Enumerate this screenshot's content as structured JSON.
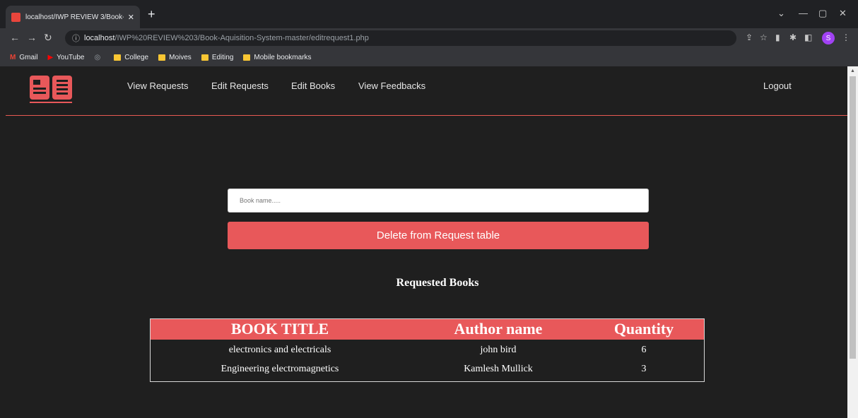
{
  "browser": {
    "tab_title": "localhost/IWP REVIEW 3/Book-A",
    "tab_close": "✕",
    "new_tab": "+",
    "url_host": "localhost",
    "url_path": "/IWP%20REVIEW%203/Book-Aquisition-System-master/editrequest1.php",
    "profile_initial": "S",
    "bookmarks": [
      {
        "label": "Gmail",
        "icon": "gmail-icon"
      },
      {
        "label": "YouTube",
        "icon": "youtube-icon"
      },
      {
        "label": "",
        "icon": "globe-icon"
      },
      {
        "label": "College",
        "icon": "folder-icon"
      },
      {
        "label": "Moives",
        "icon": "folder-icon"
      },
      {
        "label": "Editing",
        "icon": "folder-icon"
      },
      {
        "label": "Mobile bookmarks",
        "icon": "folder-icon"
      }
    ]
  },
  "nav": {
    "links": [
      "View Requests",
      "Edit Requests",
      "Edit Books",
      "View Feedbacks"
    ],
    "logout": "Logout"
  },
  "form": {
    "placeholder": "Book name.....",
    "delete_label": "Delete from Request table"
  },
  "section_title": "Requested Books",
  "table": {
    "headers": [
      "BOOK TITLE",
      "Author name",
      "Quantity"
    ],
    "rows": [
      [
        "electronics and electricals",
        "john bird",
        "6"
      ],
      [
        "Engineering electromagnetics",
        "Kamlesh Mullick",
        "3"
      ]
    ]
  },
  "colors": {
    "accent": "#e8585a",
    "background": "#1f1f1f",
    "navbar_border": "#e75a53"
  }
}
